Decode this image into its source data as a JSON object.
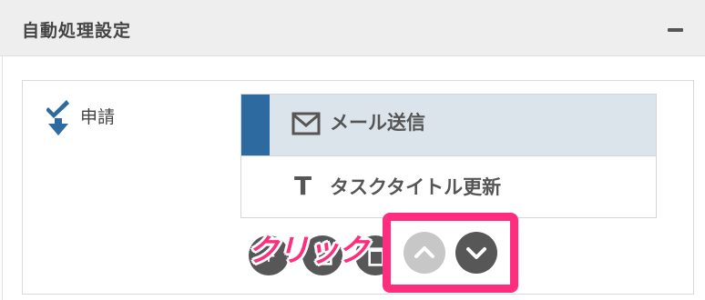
{
  "panel": {
    "title": "自動処理設定"
  },
  "trigger": {
    "label": "申請",
    "icon": "check-arrow-down-icon"
  },
  "actions": [
    {
      "label": "メール送信",
      "icon": "mail-icon",
      "selected": true
    },
    {
      "label": "タスクタイトル更新",
      "icon": "text-t-icon",
      "selected": false
    }
  ],
  "toolbar": {
    "buttons": [
      {
        "name": "add",
        "icon": "plus-icon"
      },
      {
        "name": "copy",
        "icon": "copy-icon"
      },
      {
        "name": "delete",
        "icon": "trash-icon"
      },
      {
        "name": "move-up",
        "icon": "chevron-up-icon",
        "disabled": true
      },
      {
        "name": "move-down",
        "icon": "chevron-down-icon",
        "disabled": false
      }
    ]
  },
  "annotation": {
    "text": "クリック",
    "color": "#ff2d7d"
  },
  "colors": {
    "accent": "#2d6aa0",
    "selected_bg": "#dbe4ea",
    "button_dark": "#575757",
    "button_disabled": "#c7c7c7",
    "highlight": "#ff2d7d"
  }
}
